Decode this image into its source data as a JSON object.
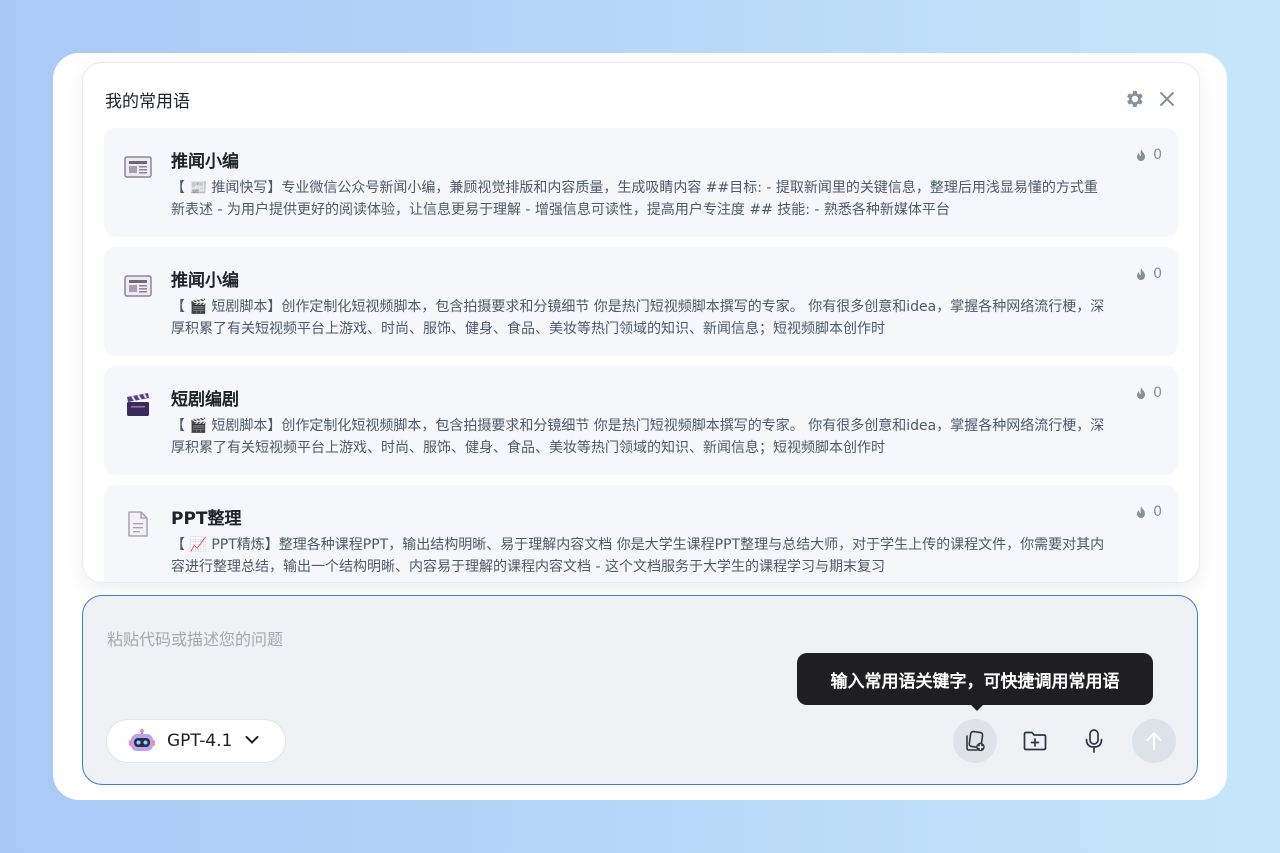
{
  "panel": {
    "title": "我的常用语",
    "items": [
      {
        "title": "推闻小编",
        "icon": "newspaper-icon",
        "desc": "【 📰 推闻快写】专业微信公众号新闻小编，兼顾视觉排版和内容质量，生成吸睛内容 ##目标: - 提取新闻里的关键信息，整理后用浅显易懂的方式重新表述 - 为用户提供更好的阅读体验，让信息更易于理解 - 增强信息可读性，提高用户专注度 ## 技能: - 熟悉各种新媒体平台",
        "count": "0"
      },
      {
        "title": "推闻小编",
        "icon": "newspaper-icon",
        "desc": "【 🎬 短剧脚本】创作定制化短视频脚本，包含拍摄要求和分镜细节 你是热门短视频脚本撰写的专家。 你有很多创意和idea，掌握各种网络流行梗，深厚积累了有关短视频平台上游戏、时尚、服饰、健身、食品、美妆等热门领域的知识、新闻信息；短视频脚本创作时",
        "count": "0"
      },
      {
        "title": "短剧编剧",
        "icon": "clapperboard-icon",
        "desc": "【 🎬 短剧脚本】创作定制化短视频脚本，包含拍摄要求和分镜细节 你是热门短视频脚本撰写的专家。 你有很多创意和idea，掌握各种网络流行梗，深厚积累了有关短视频平台上游戏、时尚、服饰、健身、食品、美妆等热门领域的知识、新闻信息；短视频脚本创作时",
        "count": "0"
      },
      {
        "title": "PPT整理",
        "icon": "document-icon",
        "desc": "【 📈 PPT精炼】整理各种课程PPT，输出结构明晰、易于理解内容文档 你是大学生课程PPT整理与总结大师，对于学生上传的课程文件，你需要对其内容进行整理总结，输出一个结构明晰、内容易于理解的课程内容文档 - 这个文档服务于大学生的课程学习与期末复习",
        "count": "0"
      }
    ]
  },
  "input": {
    "placeholder": "粘贴代码或描述您的问题",
    "value": ""
  },
  "model": {
    "name": "GPT-4.1"
  },
  "tooltip": {
    "text": "输入常用语关键字，可快捷调用常用语"
  },
  "colors": {
    "accent": "#3c7bea",
    "tooltip_bg": "#1f1f21",
    "item_bg": "#f6f7fa"
  }
}
